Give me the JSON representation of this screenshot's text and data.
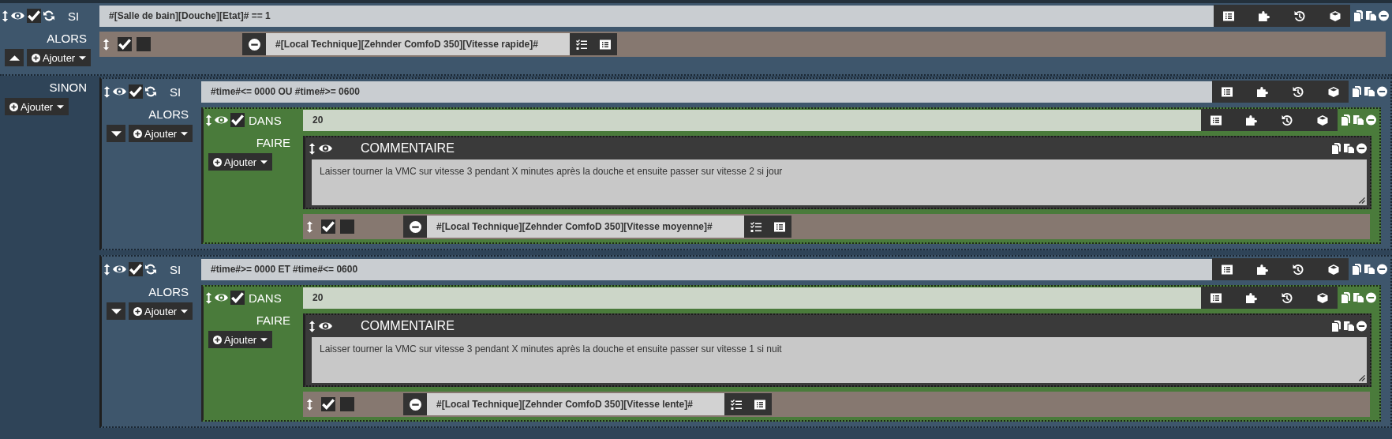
{
  "scenario": {
    "kind": "if",
    "label": "SI",
    "visible": true,
    "enabled": true,
    "condition": "#[Salle de bain][Douche][Etat]# == 1",
    "then": {
      "label": "ALORS",
      "add_button": "Ajouter",
      "items": [
        {
          "kind": "action",
          "enabled": true,
          "parallel": false,
          "command": "#[Local Technique][Zehnder ComfoD 350][Vitesse rapide]#"
        }
      ]
    },
    "else_expanded": true,
    "else": {
      "label": "SINON",
      "add_button": "Ajouter",
      "items": [
        {
          "kind": "if",
          "label": "SI",
          "visible": true,
          "enabled": true,
          "condition": "#time#<= 0000 OU #time#>= 0600",
          "else_expanded": false,
          "then": {
            "label": "ALORS",
            "add_button": "Ajouter",
            "items": [
              {
                "kind": "in",
                "label": "DANS",
                "visible": true,
                "enabled": true,
                "delay": "20",
                "do": {
                  "label": "FAIRE",
                  "add_button": "Ajouter",
                  "items": [
                    {
                      "kind": "comment",
                      "label": "COMMENTAIRE",
                      "visible": true,
                      "text": "Laisser tourner la VMC sur vitesse 3 pendant X minutes après la douche et ensuite passer sur vitesse 2 si jour"
                    },
                    {
                      "kind": "action",
                      "enabled": true,
                      "parallel": false,
                      "command": "#[Local Technique][Zehnder ComfoD 350][Vitesse moyenne]#"
                    }
                  ]
                }
              }
            ]
          }
        },
        {
          "kind": "if",
          "label": "SI",
          "visible": true,
          "enabled": true,
          "condition": "#time#>= 0000 ET #time#<= 0600",
          "else_expanded": false,
          "then": {
            "label": "ALORS",
            "add_button": "Ajouter",
            "items": [
              {
                "kind": "in",
                "label": "DANS",
                "visible": true,
                "enabled": true,
                "delay": "20",
                "do": {
                  "label": "FAIRE",
                  "add_button": "Ajouter",
                  "items": [
                    {
                      "kind": "comment",
                      "label": "COMMENTAIRE",
                      "visible": true,
                      "text": "Laisser tourner la VMC sur vitesse 3 pendant X minutes après la douche et ensuite passer sur vitesse 1 si nuit"
                    },
                    {
                      "kind": "action",
                      "enabled": true,
                      "parallel": false,
                      "command": "#[Local Technique][Zehnder ComfoD 350][Vitesse lente]#"
                    }
                  ]
                }
              }
            ]
          }
        }
      ]
    }
  }
}
